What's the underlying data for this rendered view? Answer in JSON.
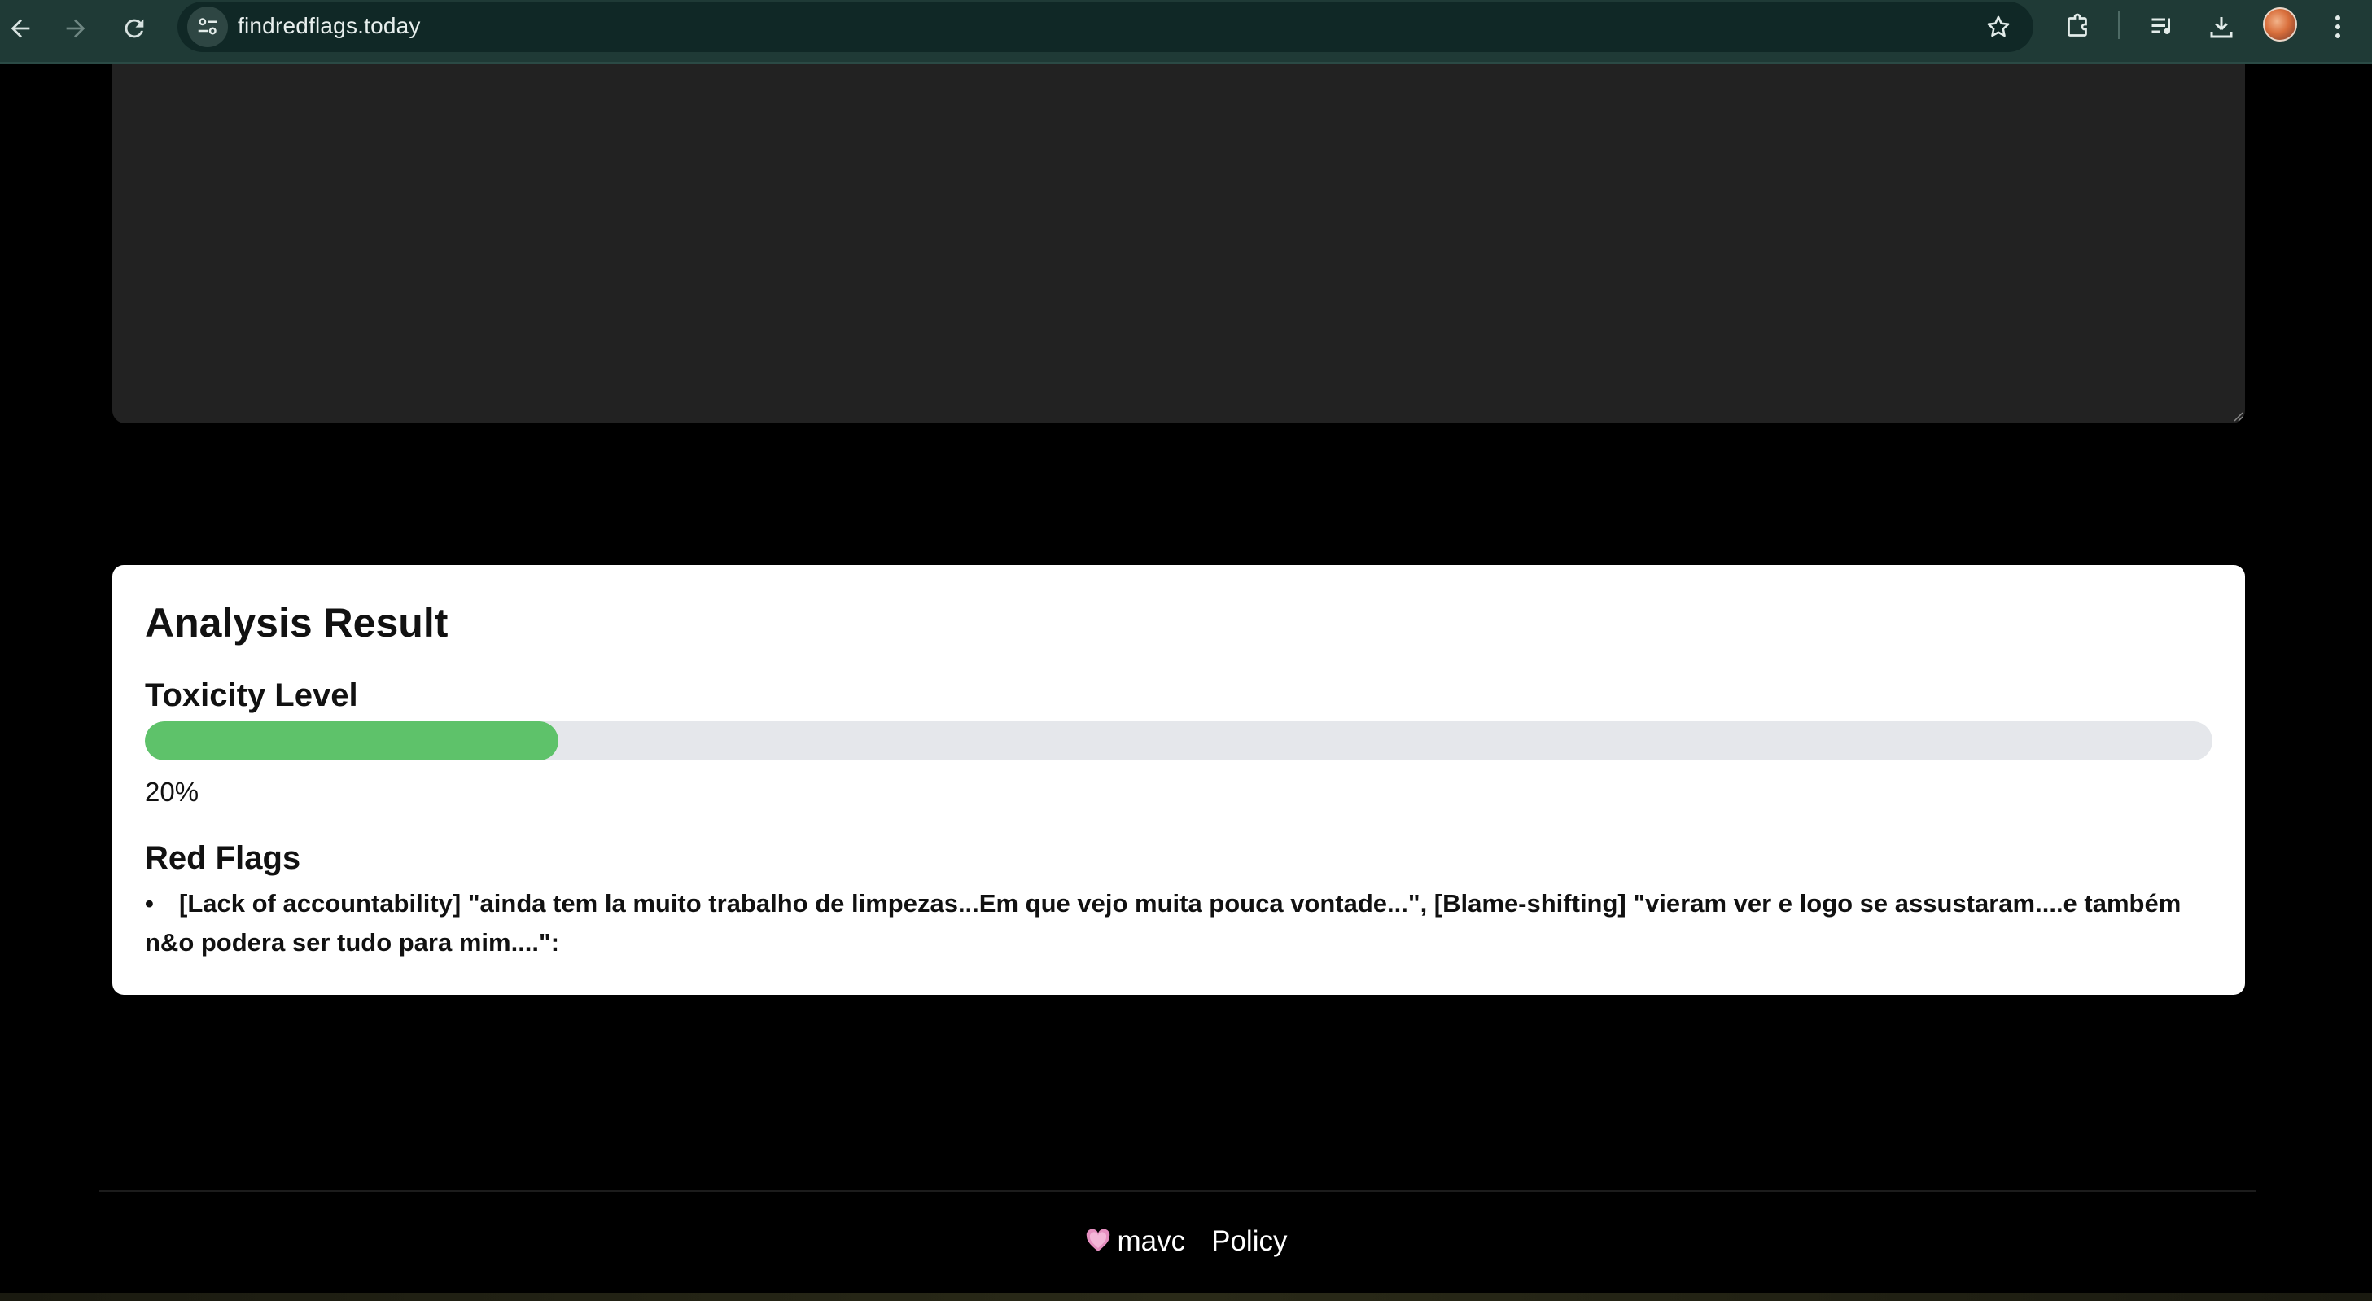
{
  "browser": {
    "url": "findredflags.today",
    "icons": {
      "back": "arrow-left-icon",
      "forward": "arrow-right-icon",
      "reload": "reload-icon",
      "site_info": "tune-icon",
      "bookmark": "star-icon",
      "extensions": "puzzle-icon",
      "media": "queue-music-icon",
      "downloads": "download-icon",
      "menu": "kebab-menu-icon"
    },
    "colors": {
      "toolbar": "#1f3a36",
      "urlbar": "#102826"
    }
  },
  "input": {
    "value": ""
  },
  "result": {
    "title": "Analysis Result",
    "toxicity": {
      "label": "Toxicity Level",
      "percent": 20,
      "value_text": "20%",
      "bar_color": "#5ec26a",
      "track_color": "#e5e7eb"
    },
    "red_flags": {
      "label": "Red Flags",
      "items": [
        "[Lack of accountability] \"ainda tem la muito trabalho de limpezas...Em que vejo muita pouca vontade...\", [Blame-shifting] \"vieram ver e logo se assustaram....e também n&o podera ser tudo para mim....\":"
      ]
    }
  },
  "footer": {
    "heart_icon": "heart-icon",
    "brand": "mavc",
    "policy_link": "Policy"
  }
}
